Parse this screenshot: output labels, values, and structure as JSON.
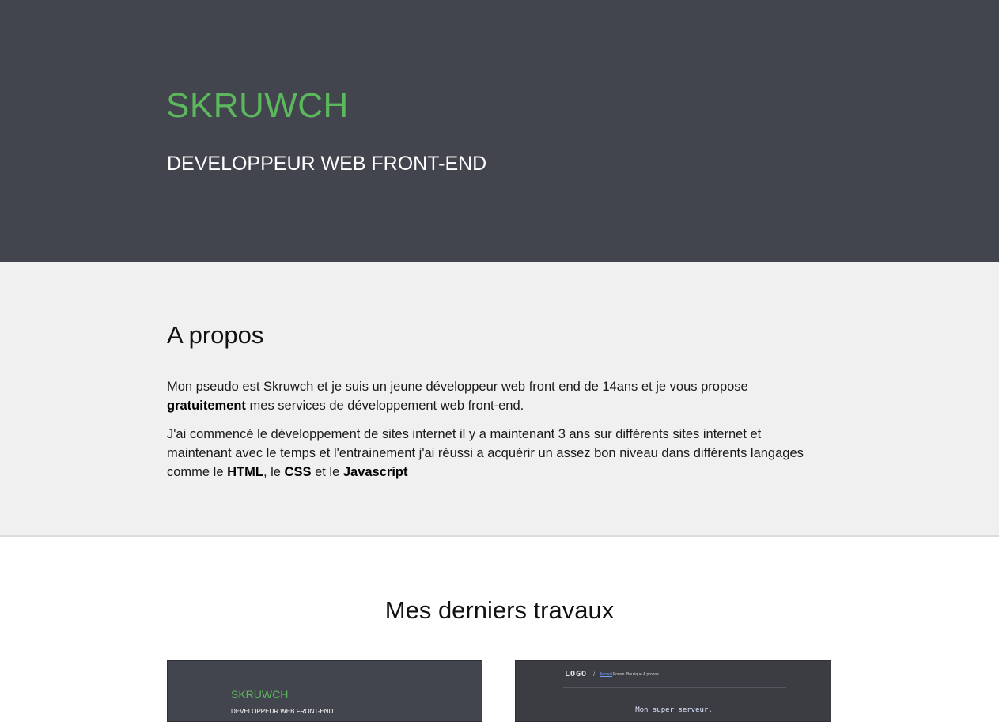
{
  "hero": {
    "title": "SKRUWCH",
    "subtitle": "DEVELOPPEUR WEB FRONT-END"
  },
  "about": {
    "heading": "A propos",
    "p1_before": "Mon pseudo est Skruwch et je suis un jeune développeur web front end de 14ans et je vous propose ",
    "p1_bold": "gratuitement",
    "p1_after": " mes services de développement web front-end.",
    "p2_before": "J'ai commencé le développement de sites internet il y a maintenant 3 ans sur différents sites internet et maintenant avec le temps et l'entrainement j'ai réussi a acquérir un assez bon niveau dans différents langages comme le ",
    "p2_html": "HTML",
    "p2_sep1": ", le ",
    "p2_css": "CSS",
    "p2_sep2": " et le ",
    "p2_js": "Javascript"
  },
  "works": {
    "heading": "Mes derniers travaux",
    "thumb1": {
      "title": "SKRUWCH",
      "subtitle": "DEVELOPPEUR WEB FRONT-END"
    },
    "thumb2": {
      "logo": "LOGO",
      "separator": "/",
      "nav": [
        "Accueil",
        "Forum",
        "Boutique",
        "A propos"
      ],
      "hero_text": "Mon super serveur."
    }
  },
  "colors": {
    "hero_bg": "#42454d",
    "accent_green": "#5cb85c",
    "about_bg": "#f0f0f0"
  }
}
